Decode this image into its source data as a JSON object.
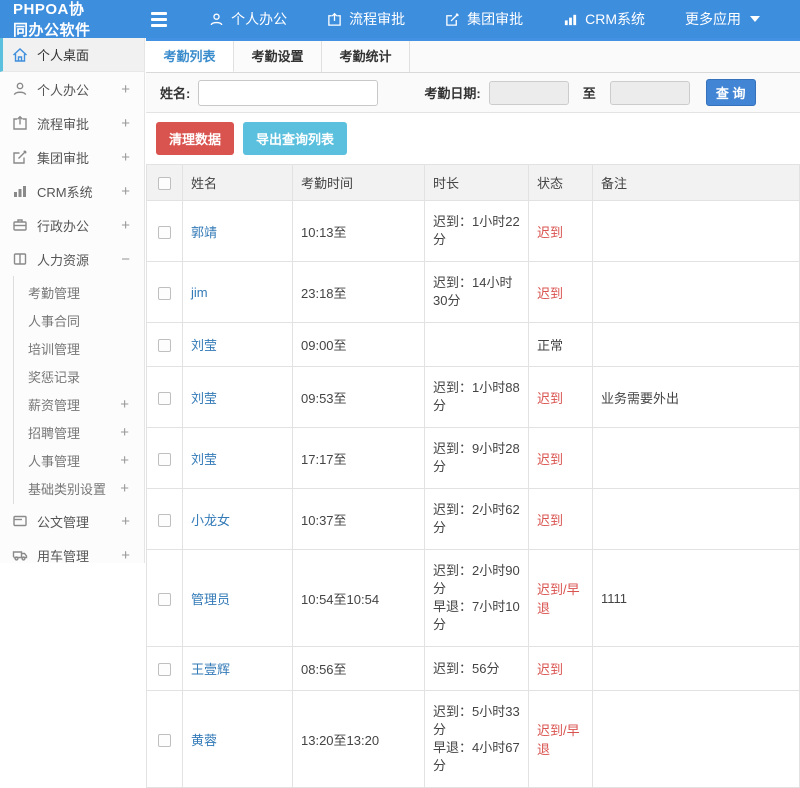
{
  "header": {
    "brand": "PHPOA协同办公软件",
    "nav": [
      {
        "label": "个人办公",
        "icon": "person-icon"
      },
      {
        "label": "流程审批",
        "icon": "workflow-icon"
      },
      {
        "label": "集团审批",
        "icon": "edit-icon"
      },
      {
        "label": "CRM系统",
        "icon": "chart-icon"
      },
      {
        "label": "更多应用",
        "icon": "caret-down-icon"
      }
    ]
  },
  "sidebar": {
    "items": [
      {
        "label": "个人桌面",
        "icon": "home-icon",
        "toggle": ""
      },
      {
        "label": "个人办公",
        "icon": "person-icon",
        "toggle": "+"
      },
      {
        "label": "流程审批",
        "icon": "workflow-icon",
        "toggle": "+"
      },
      {
        "label": "集团审批",
        "icon": "edit-icon",
        "toggle": "+"
      },
      {
        "label": "CRM系统",
        "icon": "chart-icon",
        "toggle": "+"
      },
      {
        "label": "行政办公",
        "icon": "briefcase-icon",
        "toggle": "+"
      },
      {
        "label": "人力资源",
        "icon": "book-icon",
        "toggle": "−"
      },
      {
        "label": "公文管理",
        "icon": "document-icon",
        "toggle": "+"
      },
      {
        "label": "用车管理",
        "icon": "car-icon",
        "toggle": "+"
      }
    ],
    "hr_children": [
      {
        "label": "考勤管理",
        "toggle": ""
      },
      {
        "label": "人事合同",
        "toggle": ""
      },
      {
        "label": "培训管理",
        "toggle": ""
      },
      {
        "label": "奖惩记录",
        "toggle": ""
      },
      {
        "label": "薪资管理",
        "toggle": "+"
      },
      {
        "label": "招聘管理",
        "toggle": "+"
      },
      {
        "label": "人事管理",
        "toggle": "+"
      },
      {
        "label": "基础类别设置",
        "toggle": "+"
      }
    ]
  },
  "tabs": [
    {
      "label": "考勤列表"
    },
    {
      "label": "考勤设置"
    },
    {
      "label": "考勤统计"
    }
  ],
  "filter": {
    "name_label": "姓名:",
    "date_label": "考勤日期:",
    "to_label": "至",
    "query_button": "查 询"
  },
  "toolbar": {
    "clear_button": "清理数据",
    "export_button": "导出查询列表"
  },
  "table": {
    "columns": [
      "姓名",
      "考勤时间",
      "时长",
      "状态",
      "备注"
    ],
    "rows": [
      {
        "name": "郭靖",
        "time": "10:13至",
        "duration": "迟到：1小时22分",
        "status": "迟到",
        "status_class": "st-late",
        "note": ""
      },
      {
        "name": "jim",
        "time": "23:18至",
        "duration": "迟到：14小时30分",
        "status": "迟到",
        "status_class": "st-late",
        "note": ""
      },
      {
        "name": "刘莹",
        "time": "09:00至",
        "duration": "",
        "status": "正常",
        "status_class": "st-normal",
        "note": ""
      },
      {
        "name": "刘莹",
        "time": "09:53至",
        "duration": "迟到：1小时88分",
        "status": "迟到",
        "status_class": "st-late",
        "note": "业务需要外出"
      },
      {
        "name": "刘莹",
        "time": "17:17至",
        "duration": "迟到：9小时28分",
        "status": "迟到",
        "status_class": "st-late",
        "note": ""
      },
      {
        "name": "小龙女",
        "time": "10:37至",
        "duration": "迟到：2小时62分",
        "status": "迟到",
        "status_class": "st-late",
        "note": ""
      },
      {
        "name": "管理员",
        "time": "10:54至10:54",
        "duration": "迟到：2小时90分\n早退：7小时10分",
        "status": "迟到/早退",
        "status_class": "st-late",
        "note": "1111"
      },
      {
        "name": "王壹辉",
        "time": "08:56至",
        "duration": "迟到：56分",
        "status": "迟到",
        "status_class": "st-late",
        "note": ""
      },
      {
        "name": "黄蓉",
        "time": "13:20至13:20",
        "duration": "迟到：5小时33分\n早退：4小时67分",
        "status": "迟到/早退",
        "status_class": "st-late",
        "note": ""
      }
    ]
  },
  "colors": {
    "header_blue": "#3e8ede",
    "accent_cyan": "#5bc0de",
    "danger_red": "#d9534f",
    "link_blue": "#337ab7",
    "query_blue": "#4285d4"
  }
}
